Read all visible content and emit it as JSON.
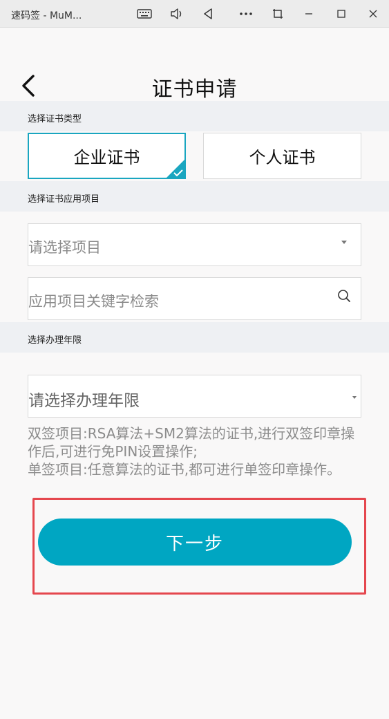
{
  "window": {
    "title": "速码签 - MuM...",
    "icons": [
      "keyboard-icon",
      "volume-icon",
      "back-triangle-icon",
      "more-icon",
      "screenshot-icon",
      "minimize-icon",
      "maximize-icon",
      "close-icon"
    ]
  },
  "header": {
    "title": "证书申请",
    "back_icon": "chevron-left-icon"
  },
  "cert_type": {
    "section_label": "选择证书类型",
    "options": [
      {
        "label": "企业证书",
        "selected": true
      },
      {
        "label": "个人证书",
        "selected": false
      }
    ],
    "accent_color": "#1aa6c0"
  },
  "project": {
    "section_label": "选择证书应用项目",
    "select_placeholder": "请选择项目",
    "search_placeholder": "应用项目关键字检索"
  },
  "duration": {
    "section_label": "选择办理年限",
    "select_placeholder": "请选择办理年限"
  },
  "notes": {
    "line1": "双签项目:RSA算法+SM2算法的证书,进行双签印章操作后,可进行免PIN设置操作;",
    "line2": "单签项目:任意算法的证书,都可进行单签印章操作。"
  },
  "actions": {
    "next_label": "下一步",
    "next_color": "#00a6c2",
    "highlight_color": "#e5474e"
  }
}
